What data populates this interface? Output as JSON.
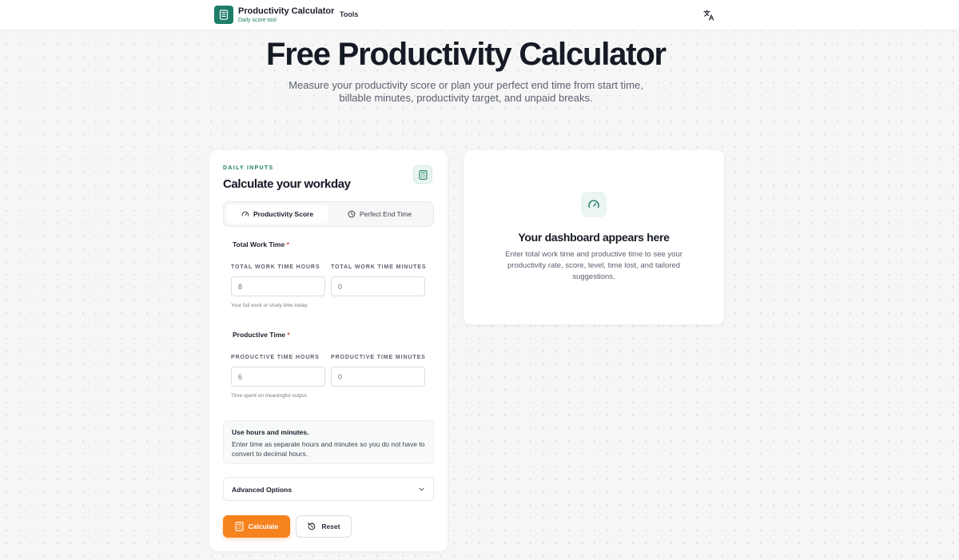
{
  "header": {
    "brand_title": "Productivity Calculator",
    "brand_subtitle": "Daily score tool",
    "nav_tools": "Tools",
    "language_icon": "translate-icon"
  },
  "hero": {
    "title": "Free Productivity Calculator",
    "subtitle": "Measure your productivity score or plan your perfect end time from start time, billable minutes, productivity target, and unpaid breaks."
  },
  "form": {
    "eyebrow": "DAILY INPUTS",
    "title": "Calculate your workday",
    "tabs": [
      {
        "label": "Productivity Score",
        "icon": "gauge-icon",
        "active": true
      },
      {
        "label": "Perfect End Time",
        "icon": "clock-icon",
        "active": false
      }
    ],
    "total_work": {
      "label": "Total Work Time",
      "required_mark": "*",
      "hours_label": "TOTAL WORK TIME HOURS",
      "hours_placeholder": "8",
      "minutes_label": "TOTAL WORK TIME MINUTES",
      "minutes_placeholder": "0",
      "hint": "Your full work or study time today."
    },
    "productive": {
      "label": "Productive Time",
      "required_mark": "*",
      "hours_label": "PRODUCTIVE TIME HOURS",
      "hours_placeholder": "6",
      "minutes_label": "PRODUCTIVE TIME MINUTES",
      "minutes_placeholder": "0",
      "hint": "Time spent on meaningful output."
    },
    "info": {
      "title": "Use hours and minutes.",
      "body": "Enter time as separate hours and minutes so you do not have to convert to decimal hours."
    },
    "advanced_label": "Advanced Options",
    "calculate_label": "Calculate",
    "reset_label": "Reset"
  },
  "dashboard": {
    "title": "Your dashboard appears here",
    "body": "Enter total work time and productive time to see your productivity rate, score, level, time lost, and tailored suggestions."
  },
  "colors": {
    "brand_green": "#1e7d68",
    "accent_orange": "#f7831f",
    "required_red": "#e0463c"
  }
}
